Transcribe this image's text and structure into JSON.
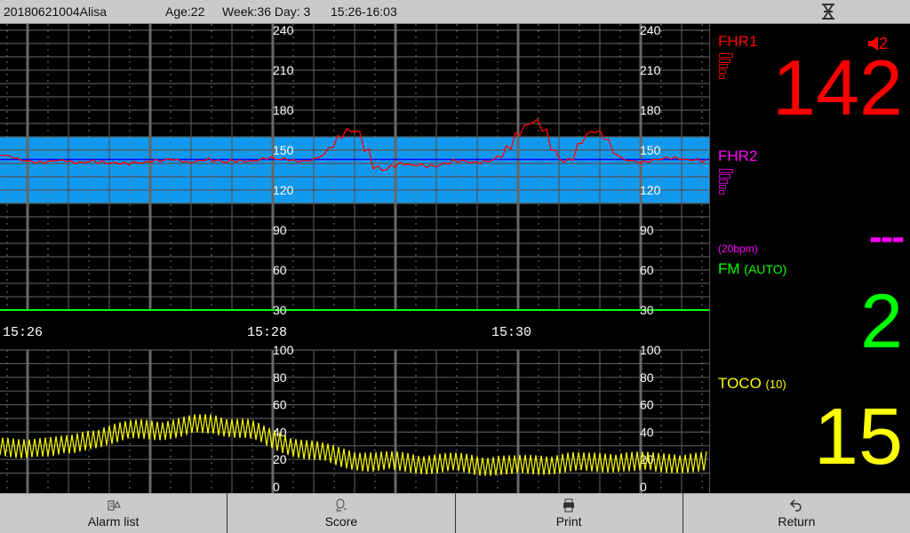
{
  "header": {
    "patient": "20180621004Alisa",
    "age": "Age:22",
    "gestation": "Week:36 Day: 3",
    "time_range": "15:26-16:03",
    "status_icon": "hourglass-icon"
  },
  "fhr_axis": {
    "labels": [
      "240",
      "210",
      "180",
      "150",
      "120",
      "90",
      "60",
      "30"
    ],
    "range": [
      30,
      240
    ],
    "normal_band": [
      110,
      160
    ]
  },
  "toco_axis": {
    "labels": [
      "100",
      "80",
      "60",
      "40",
      "20",
      "0"
    ],
    "range": [
      0,
      100
    ]
  },
  "time_labels": [
    "15:26",
    "15:28",
    "15:30"
  ],
  "fhr1_trace_bpm": [
    146,
    145,
    143,
    142,
    141,
    141,
    142,
    142,
    141,
    141,
    142,
    141,
    140,
    140,
    140,
    141,
    141,
    142,
    142,
    143,
    142,
    141,
    142,
    143,
    142,
    141,
    142,
    142,
    142,
    143,
    144,
    143,
    143,
    142,
    142,
    143,
    146,
    152,
    160,
    165,
    164,
    150,
    137,
    135,
    138,
    140,
    139,
    139,
    138,
    138,
    140,
    142,
    142,
    141,
    141,
    142,
    145,
    152,
    162,
    169,
    172,
    165,
    150,
    142,
    143,
    155,
    163,
    164,
    158,
    147,
    143,
    142,
    141,
    142,
    143,
    144,
    144,
    143,
    143,
    142
  ],
  "fhr_baseline_bpm": 143,
  "toco_trace_envelope": [
    28,
    28,
    30,
    29,
    30,
    35,
    38,
    40,
    42,
    42,
    43,
    45,
    46,
    44,
    42,
    36,
    32,
    28,
    25,
    22,
    20,
    18,
    18,
    18,
    17,
    17,
    17,
    16,
    16,
    15,
    16,
    17,
    18,
    17,
    18,
    19,
    18,
    17,
    18,
    18
  ],
  "toco_oscillation_amplitude": 8,
  "right_panel": {
    "fhr1_label": "FHR1",
    "fhr1_value": "142",
    "volume": "2",
    "volume_icon": "speaker-icon",
    "fhr2_label": "FHR2",
    "fhr2_value": "---",
    "offset": "(20bpm)",
    "fm_label": "FM",
    "fm_mode": "(AUTO)",
    "fm_value": "2",
    "toco_label": "TOCO",
    "toco_zero": "(10)",
    "toco_value": "15"
  },
  "colors": {
    "fhr1": "#ff0000",
    "fhr2": "#ff00ff",
    "fm": "#00ff00",
    "toco": "#ffff00",
    "band": "#1199ee",
    "baseline": "#0000ff"
  },
  "footer": {
    "buttons": [
      {
        "label": "Alarm list",
        "icon": "alarm-list-icon"
      },
      {
        "label": "Score",
        "icon": "score-icon"
      },
      {
        "label": "Print",
        "icon": "printer-icon"
      },
      {
        "label": "Return",
        "icon": "return-icon"
      }
    ]
  }
}
